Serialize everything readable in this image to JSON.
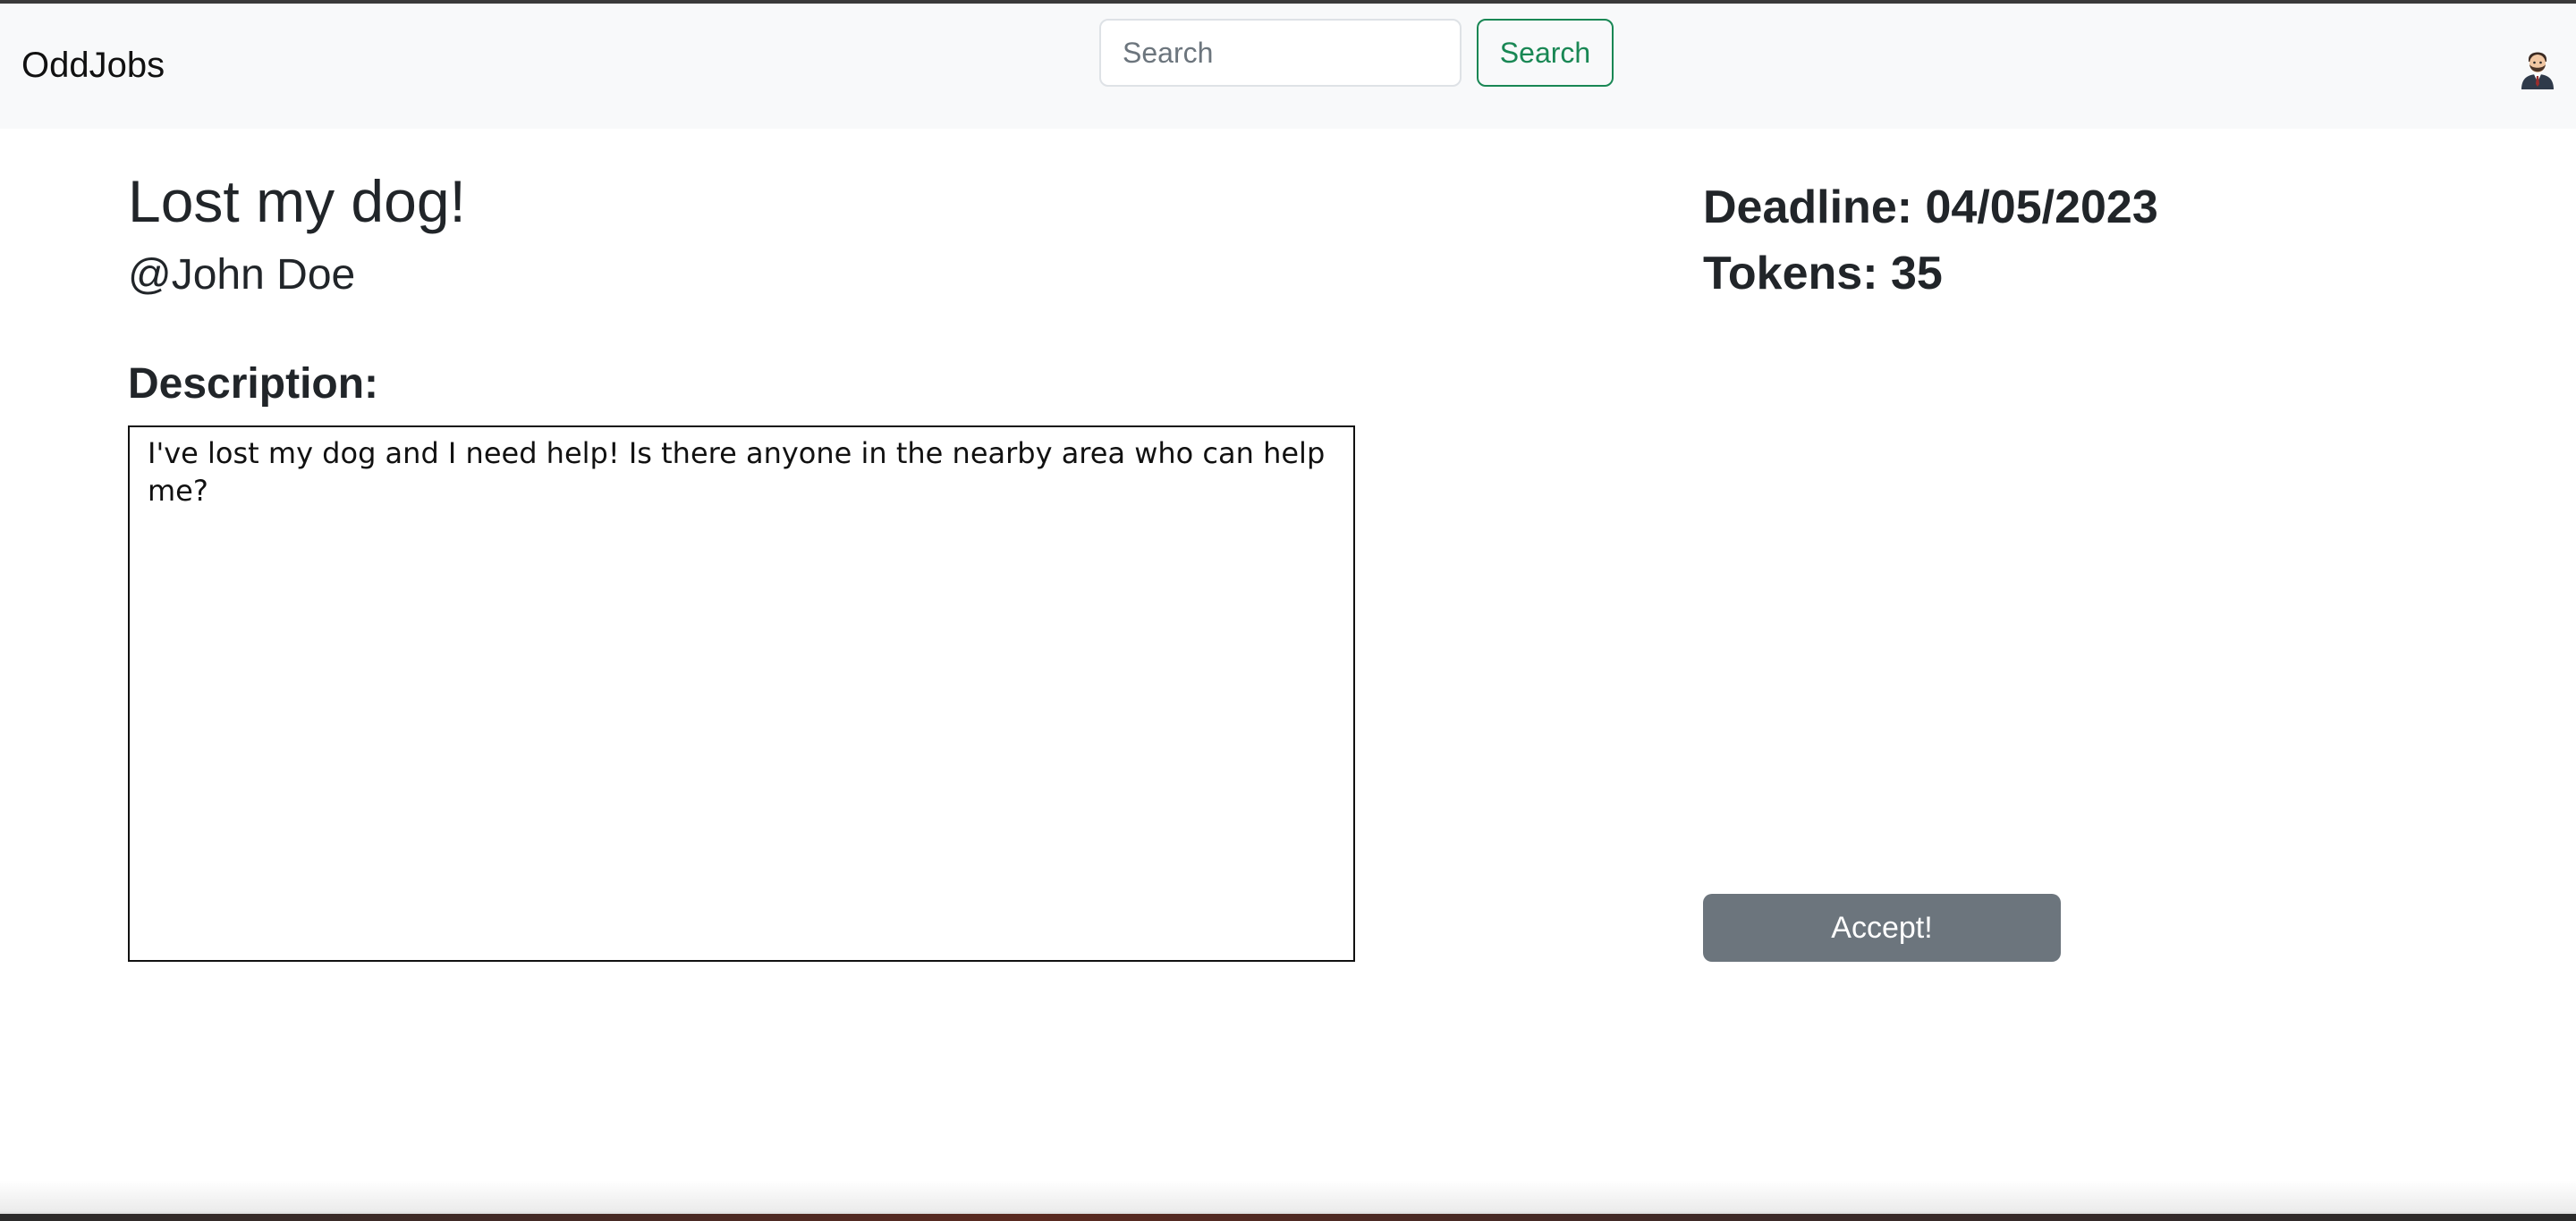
{
  "navbar": {
    "brand": "OddJobs",
    "search": {
      "placeholder": "Search",
      "value": "",
      "button_label": "Search"
    },
    "avatar_icon": "user-avatar-icon"
  },
  "job": {
    "title": "Lost my dog!",
    "author": "@John Doe",
    "description_heading": "Description:",
    "description": "I've lost my dog and I need help! Is there anyone in the nearby area who can help me?",
    "deadline": "Deadline: 04/05/2023",
    "tokens": "Tokens: 35",
    "accept_label": "Accept!"
  },
  "colors": {
    "navbar_bg": "#f8f9fa",
    "search_button": "#198754",
    "accept_button": "#6c757d",
    "text": "#212529"
  }
}
